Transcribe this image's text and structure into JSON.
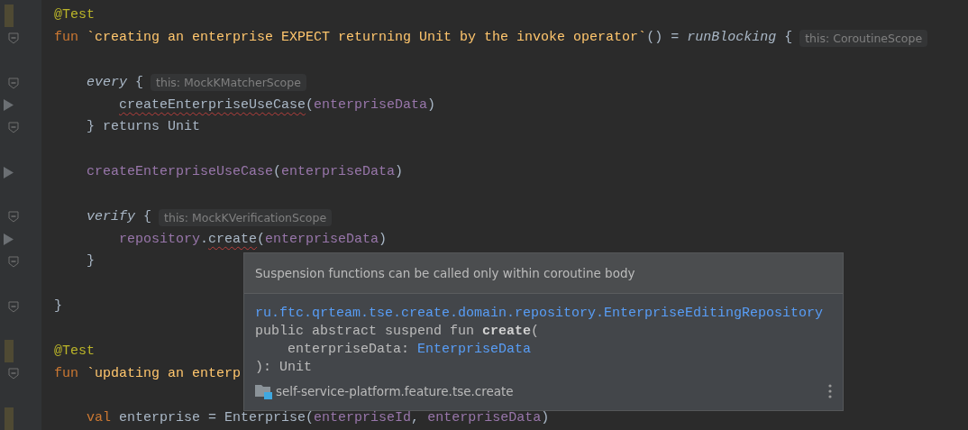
{
  "editor": {
    "lines": [
      {
        "changed": true,
        "tokens": [
          {
            "kind": "annotation",
            "text": "@Test"
          }
        ]
      },
      {
        "foldable": true,
        "tokens": [
          {
            "kind": "keyword",
            "text": "fun "
          },
          {
            "kind": "fn_name",
            "text": "`creating an enterprise EXPECT returning Unit by the invoke operator`"
          },
          {
            "kind": "plain",
            "text": "() = "
          },
          {
            "kind": "italic",
            "text": "runBlocking"
          },
          {
            "kind": "plain",
            "text": " {"
          },
          {
            "kind": "hint",
            "text": "this: CoroutineScope"
          }
        ]
      },
      {
        "blank_before": true,
        "foldable": true,
        "tokens": [
          {
            "kind": "italic",
            "text": "    every"
          },
          {
            "kind": "plain",
            "text": " {"
          },
          {
            "kind": "hint",
            "text": "this: MockKMatcherScope"
          }
        ]
      },
      {
        "run_marker": true,
        "tokens": [
          {
            "kind": "plain",
            "text": "        createEnterpriseUseCase",
            "error": true
          },
          {
            "kind": "plain",
            "text": "("
          },
          {
            "kind": "property",
            "text": "enterpriseData"
          },
          {
            "kind": "plain",
            "text": ")"
          }
        ]
      },
      {
        "foldable": true,
        "tokens": [
          {
            "kind": "plain",
            "text": "    } returns Unit"
          }
        ]
      },
      {
        "blank_before": true,
        "run_marker": true,
        "tokens": [
          {
            "kind": "property",
            "text": "    createEnterpriseUseCase"
          },
          {
            "kind": "plain",
            "text": "("
          },
          {
            "kind": "property",
            "text": "enterpriseData"
          },
          {
            "kind": "plain",
            "text": ")"
          }
        ]
      },
      {
        "blank_before": true,
        "foldable": true,
        "tokens": [
          {
            "kind": "italic",
            "text": "    verify"
          },
          {
            "kind": "plain",
            "text": " {"
          },
          {
            "kind": "hint",
            "text": "this: MockKVerificationScope"
          }
        ]
      },
      {
        "run_marker": true,
        "tokens": [
          {
            "kind": "property",
            "text": "        repository"
          },
          {
            "kind": "plain",
            "text": "."
          },
          {
            "kind": "plain",
            "text": "create",
            "error": true
          },
          {
            "kind": "plain",
            "text": "("
          },
          {
            "kind": "property",
            "text": "enterpriseData"
          },
          {
            "kind": "plain",
            "text": ")"
          }
        ]
      },
      {
        "foldable": true,
        "tokens": [
          {
            "kind": "plain",
            "text": "    }"
          }
        ]
      },
      {
        "blank_before": true,
        "foldable": true,
        "tokens": [
          {
            "kind": "plain",
            "text": "}"
          }
        ]
      },
      {
        "blank_before": true,
        "changed": true,
        "tokens": [
          {
            "kind": "annotation",
            "text": "@Test"
          }
        ]
      },
      {
        "foldable": true,
        "tokens": [
          {
            "kind": "keyword",
            "text": "fun "
          },
          {
            "kind": "fn_name",
            "text": "`updating an enterp"
          }
        ]
      },
      {
        "blank_before": true,
        "changed": true,
        "tokens": [
          {
            "kind": "keyword",
            "text": "    val "
          },
          {
            "kind": "plain",
            "text": "enterprise = Enterprise("
          },
          {
            "kind": "property",
            "text": "enterpriseId"
          },
          {
            "kind": "plain",
            "text": ", "
          },
          {
            "kind": "property",
            "text": "enterpriseData"
          },
          {
            "kind": "plain",
            "text": ")"
          }
        ]
      }
    ]
  },
  "popup": {
    "message": "Suspension functions can be called only within coroutine body",
    "doc_lines": [
      {
        "tokens": [
          {
            "kind": "link",
            "text": "ru.ftc.qrteam.tse.create.domain.repository.EnterpriseEditingRepository"
          }
        ]
      },
      {
        "tokens": [
          {
            "kind": "plain",
            "text": "public abstract suspend fun "
          },
          {
            "kind": "bold",
            "text": "create"
          },
          {
            "kind": "plain",
            "text": "("
          }
        ]
      },
      {
        "tokens": [
          {
            "kind": "plain",
            "text": "    enterpriseData: "
          },
          {
            "kind": "link",
            "text": "EnterpriseData"
          }
        ]
      },
      {
        "tokens": [
          {
            "kind": "plain",
            "text": "): Unit"
          }
        ]
      }
    ],
    "module": "self-service-platform.feature.tse.create"
  }
}
